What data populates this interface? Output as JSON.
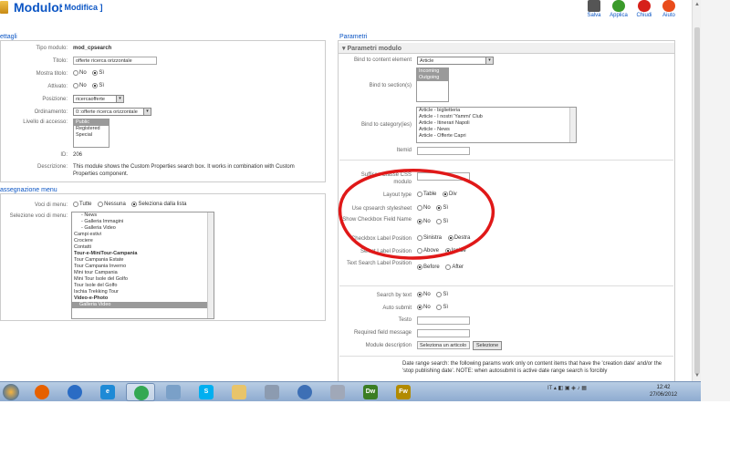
{
  "header": {
    "title": "Modulo:",
    "subtitle": "[ Modifica ]",
    "toolbar": [
      {
        "label": "Salva",
        "icon": "save-icon"
      },
      {
        "label": "Applica",
        "icon": "apply-icon"
      },
      {
        "label": "Chiudi",
        "icon": "close-icon"
      },
      {
        "label": "Aiuto",
        "icon": "help-icon"
      }
    ]
  },
  "left": {
    "section_title": "ettagli",
    "fields": {
      "tipo_label": "Tipo modulo:",
      "tipo_value": "mod_cpsearch",
      "titolo_label": "Titolo:",
      "titolo_value": "offerte ricerca orizzontale",
      "mostra_label": "Mostra titolo:",
      "attivato_label": "Attivato:",
      "posizione_label": "Posizione:",
      "posizione_value": "ricercaofferte",
      "ordinamento_label": "Ordinamento:",
      "ordinamento_value": "0::offerte ricerca orizzontale",
      "livello_label": "Livello di accesso:",
      "access_options": [
        "Public",
        "Registered",
        "Special"
      ],
      "id_label": "ID:",
      "id_value": "206",
      "descrizione_label": "Descrizione:",
      "descrizione_value": "This module shows the Custom Properties search box. It works in combination with Custom Properties component.",
      "no": "No",
      "si": "Sì"
    },
    "menu_section_title": "assegnazione menu",
    "menu": {
      "voci_label": "Voci di menu:",
      "options": [
        "Tutte",
        "Nessuna",
        "Seleziona dalla lista"
      ],
      "seleziona_label": "Selezione voci di menu:",
      "items": [
        {
          "t": "- News",
          "i": 1
        },
        {
          "t": "- Galleria Immagini",
          "i": 1
        },
        {
          "t": "- Galleria Video",
          "i": 1
        },
        {
          "t": "Campi estivi",
          "i": 0
        },
        {
          "t": "Crociere",
          "i": 0
        },
        {
          "t": "Contatti",
          "i": 0
        },
        {
          "t": "Tour-e-MiniTour-Campania",
          "i": -1
        },
        {
          "t": "Tour Campania Estate",
          "i": 0
        },
        {
          "t": "Tour Campania Inverno",
          "i": 0
        },
        {
          "t": "Mini tour Campania",
          "i": 0
        },
        {
          "t": "Mini Tour Isole del Golfo",
          "i": 0
        },
        {
          "t": "Tour Isole del Golfo",
          "i": 0
        },
        {
          "t": "Ischia Trekking Tour",
          "i": 0
        },
        {
          "t": "Video-e-Photo",
          "i": -1
        },
        {
          "t": "Galleria Video",
          "i": 2
        }
      ]
    }
  },
  "right": {
    "section_title": "Parametri",
    "subsection_title": "Parametri modulo",
    "bind_content_label": "Bind to content element",
    "bind_content_value": "Article",
    "bind_section_label": "Bind to section(s)",
    "sections": [
      "Incoming",
      "Outgoing"
    ],
    "bind_category_label": "Bind to category(ies)",
    "categories": [
      "Article - biglietteria",
      "Article - I nostri 'Yammi' Club",
      "Article - Itinerari Napoli",
      "Article - News",
      "Article - Offerte Capri"
    ],
    "itemid_label": "Itemid",
    "suffix_label": "Suffisso Classe CSS modulo",
    "layout_label": "Layout type",
    "layout_opts": [
      "Table",
      "Div"
    ],
    "usecss_label": "Use cpsearch stylesheet",
    "showcb_label": "Show Checkbox Field Name",
    "cbpos_label": "Checkbox Label Position",
    "cbpos_opts": [
      "Sinistra",
      "Destra"
    ],
    "selpos_label": "Select Label Position",
    "selpos_opts": [
      "Above",
      "Inside"
    ],
    "textpos_label": "Text Search Label Position",
    "textpos_opts": [
      "Before",
      "After"
    ],
    "searchtext_label": "Search by text",
    "autosubmit_label": "Auto submit",
    "testo_label": "Testo",
    "required_label": "Required field message",
    "moddesc_label": "Module description",
    "moddesc_value": "Seleziona un articolo",
    "selezione_btn": "Selezione",
    "note": "Date range search: the following params work only on content items that have the 'creation date' and/or the 'stop publishing date'. NOTE: when autosubmit is active date range search is forcibly",
    "no": "No",
    "si": "Sì"
  },
  "taskbar": {
    "apps": [
      {
        "icon": "firefox-icon",
        "color": "#e66000",
        "txt": ""
      },
      {
        "icon": "thunderbird-icon",
        "color": "#2a6cc4",
        "txt": ""
      },
      {
        "icon": "ie-icon",
        "color": "#1e8ad6",
        "txt": "e"
      },
      {
        "icon": "chrome-icon",
        "color": "#34a853",
        "txt": ""
      },
      {
        "icon": "app-icon",
        "color": "#7aa0c8",
        "txt": ""
      },
      {
        "icon": "skype-icon",
        "color": "#00aff0",
        "txt": "S"
      },
      {
        "icon": "explorer-icon",
        "color": "#e8c46a",
        "txt": ""
      },
      {
        "icon": "calculator-icon",
        "color": "#8c9bb0",
        "txt": ""
      },
      {
        "icon": "thunderbird2-icon",
        "color": "#3d6fb5",
        "txt": ""
      },
      {
        "icon": "tools-icon",
        "color": "#a0a8b8",
        "txt": ""
      },
      {
        "icon": "dreamweaver-icon",
        "color": "#3b7d23",
        "txt": "Dw"
      },
      {
        "icon": "fireworks-icon",
        "color": "#b28a00",
        "txt": "Fw"
      }
    ],
    "lang": "IT",
    "time": "12:42",
    "date": "27/06/2012"
  }
}
